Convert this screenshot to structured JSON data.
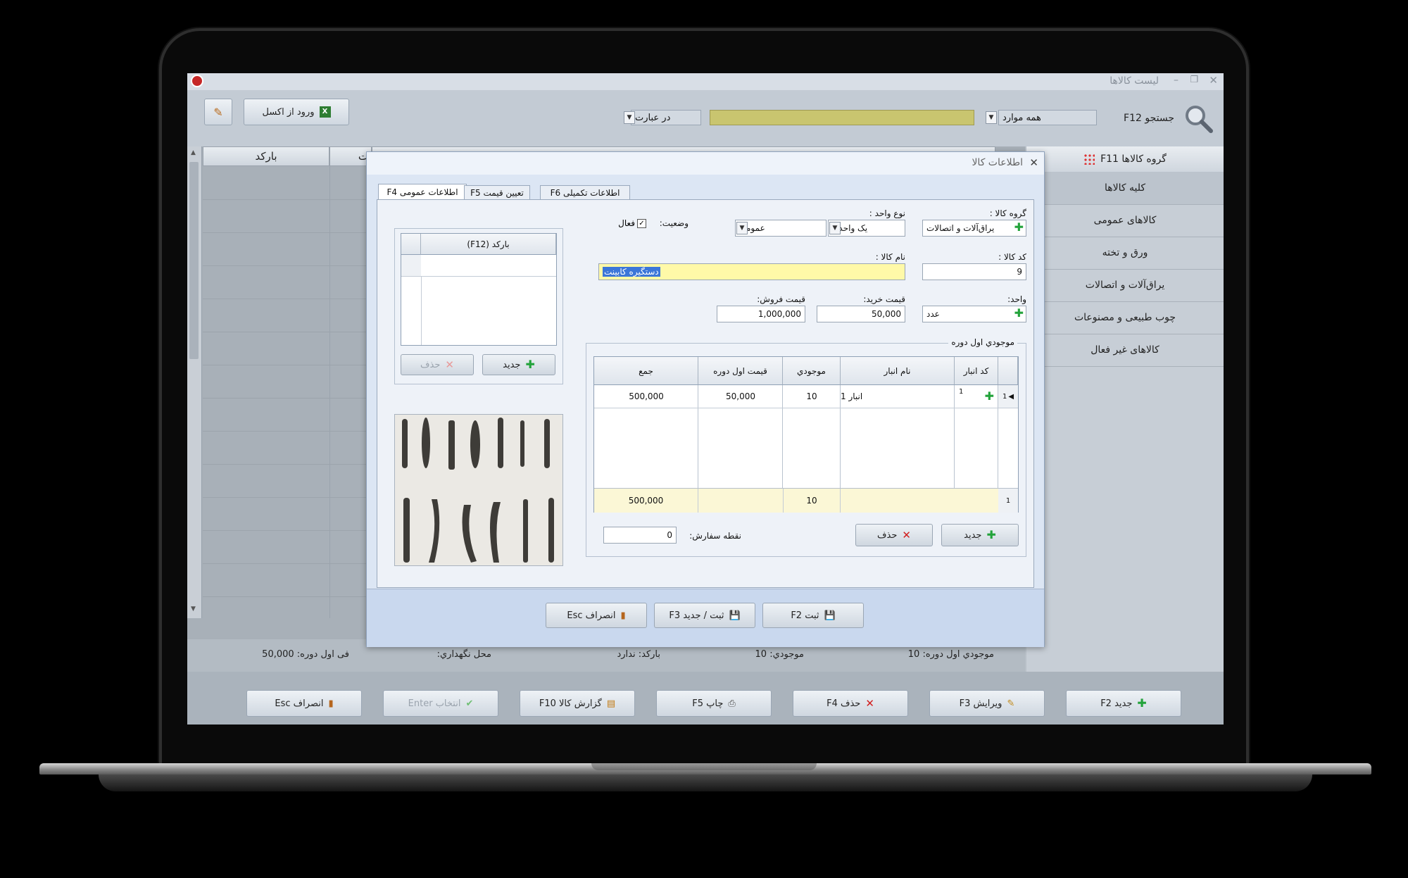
{
  "window": {
    "title": "ليست كالاها"
  },
  "toolbar": {
    "search_label": "جستجو F12",
    "search_scope": "همه موارد",
    "search_mode": "در عبارت",
    "import_excel": "ورود از اکسل"
  },
  "grid": {
    "col_barcode": "بارکد",
    "col_partial": "ت"
  },
  "sidebar": {
    "header": "گروه کالاها F11",
    "items": [
      "کلیه کالاها",
      "کالاهای عمومی",
      "ورق و تخته",
      "یراق‌آلات و اتصالات",
      "چوب طبیعی و مصنوعات",
      "کالاهای غیر فعال"
    ]
  },
  "statusbar": {
    "opening_stock": "موجودي اول دوره: 10",
    "stock": "موجودي: 10",
    "barcode": "بارکد: ندارد",
    "storage": "محل نگهداري:",
    "opening_price": "فی اول دوره: 50,000"
  },
  "bottom_buttons": {
    "new": "جدید F2",
    "edit": "ویرایش F3",
    "delete": "حذف F4",
    "print": "چاپ F5",
    "report": "گزارش کالا F10",
    "select": "انتخاب Enter",
    "cancel": "انصراف Esc"
  },
  "dialog": {
    "title": "اطلاعات کالا",
    "tabs": {
      "general": "اطلاعات عمومی F4",
      "pricing": "تعیین قیمت F5",
      "extra": "اطلاعات تکمیلی F6"
    },
    "group_label": "گروه کالا :",
    "group_value": "یراق‌آلات و اتصالات",
    "unit_type_label": "نوع واحد :",
    "unit_type_value": "یک واحدي",
    "unit_kind_value": "عمومی",
    "status_label": "وضعیت:",
    "active_label": "فعال",
    "code_label": "کد کالا :",
    "code_value": "9",
    "name_label": "نام کالا :",
    "name_value": "دستگیره کابینت",
    "unit_label": "واحد:",
    "unit_value": "عدد",
    "buy_label": "قیمت خرید:",
    "buy_value": "50,000",
    "sell_label": "قیمت فروش:",
    "sell_value": "1,000,000",
    "barcode_col": "(F12) بارکد",
    "barcode_new": "جدید",
    "barcode_delete": "حذف",
    "stock_group": "موجودي اول دوره",
    "stock_cols": {
      "code": "کد انبار",
      "name": "نام انبار",
      "stock": "موجودي",
      "price": "قیمت اول دوره",
      "total": "جمع"
    },
    "stock_row": {
      "num": "1",
      "code": "1",
      "name": "انبار 1",
      "stock": "10",
      "price": "50,000",
      "total": "500,000"
    },
    "stock_footer": {
      "num": "1",
      "stock": "10",
      "total": "500,000"
    },
    "stock_new": "جدید",
    "stock_delete": "حذف",
    "reorder_label": "نقطه سفارش:",
    "reorder_value": "0",
    "save": "ثبت F2",
    "save_new": "ثبت / جدید F3",
    "cancel": "انصراف Esc"
  }
}
